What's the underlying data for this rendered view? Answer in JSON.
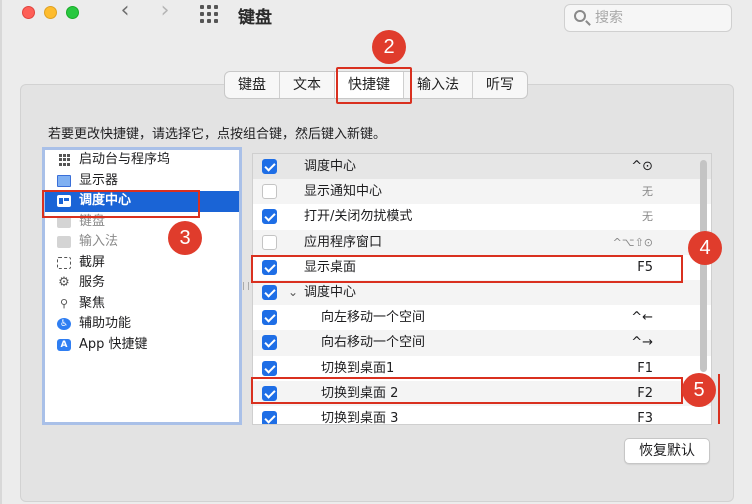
{
  "window": {
    "title": "键盘"
  },
  "search": {
    "placeholder": "搜索"
  },
  "tabs": [
    {
      "label": "键盘",
      "active": false
    },
    {
      "label": "文本",
      "active": false
    },
    {
      "label": "快捷键",
      "active": true
    },
    {
      "label": "输入法",
      "active": false
    },
    {
      "label": "听写",
      "active": false
    }
  ],
  "instruction": "若要更改快捷键，请选择它，点按组合键，然后键入新键。",
  "categories": [
    {
      "label": "启动台与程序坞",
      "icon": "launchpad-icon",
      "selected": false,
      "dim": false
    },
    {
      "label": "显示器",
      "icon": "display-icon",
      "selected": false,
      "dim": false
    },
    {
      "label": "调度中心",
      "icon": "mission-control-icon",
      "selected": true,
      "dim": false
    },
    {
      "label": "键盘",
      "icon": "keyboard-icon",
      "selected": false,
      "dim": true
    },
    {
      "label": "输入法",
      "icon": "input-source-icon",
      "selected": false,
      "dim": true
    },
    {
      "label": "截屏",
      "icon": "screenshot-icon",
      "selected": false,
      "dim": false
    },
    {
      "label": "服务",
      "icon": "gear-icon",
      "selected": false,
      "dim": false
    },
    {
      "label": "聚焦",
      "icon": "spotlight-icon",
      "selected": false,
      "dim": false
    },
    {
      "label": "辅助功能",
      "icon": "accessibility-icon",
      "selected": false,
      "dim": false
    },
    {
      "label": "App 快捷键",
      "icon": "app-store-icon",
      "selected": false,
      "dim": false
    }
  ],
  "shortcuts": [
    {
      "label": "调度中心",
      "key": "^⊙",
      "checked": true,
      "indent": false,
      "group": false,
      "dimKey": false
    },
    {
      "label": "显示通知中心",
      "key": "无",
      "checked": false,
      "indent": false,
      "group": false,
      "dimKey": true
    },
    {
      "label": "打开/关闭勿扰模式",
      "key": "无",
      "checked": true,
      "indent": false,
      "group": false,
      "dimKey": true
    },
    {
      "label": "应用程序窗口",
      "key": "^⌥⇧⊙",
      "checked": false,
      "indent": false,
      "group": false,
      "dimKey": true
    },
    {
      "label": "显示桌面",
      "key": "F5",
      "checked": true,
      "indent": false,
      "group": false,
      "dimKey": false
    },
    {
      "label": "调度中心",
      "key": "",
      "checked": true,
      "indent": false,
      "group": true,
      "dimKey": false
    },
    {
      "label": "向左移动一个空间",
      "key": "^←",
      "checked": true,
      "indent": true,
      "group": false,
      "dimKey": false
    },
    {
      "label": "向右移动一个空间",
      "key": "^→",
      "checked": true,
      "indent": true,
      "group": false,
      "dimKey": false
    },
    {
      "label": "切换到桌面1",
      "key": "F1",
      "checked": true,
      "indent": true,
      "group": false,
      "dimKey": false
    },
    {
      "label": "切换到桌面 2",
      "key": "F2",
      "checked": true,
      "indent": true,
      "group": false,
      "dimKey": false
    },
    {
      "label": "切换到桌面 3",
      "key": "F3",
      "checked": true,
      "indent": true,
      "group": false,
      "dimKey": false
    }
  ],
  "callouts": [
    "2",
    "3",
    "4",
    "5"
  ],
  "buttons": {
    "restore_defaults": "恢复默认"
  },
  "colors": {
    "accent": "#1a64d6",
    "highlight": "#d9301f",
    "callout": "#e03c2c"
  }
}
